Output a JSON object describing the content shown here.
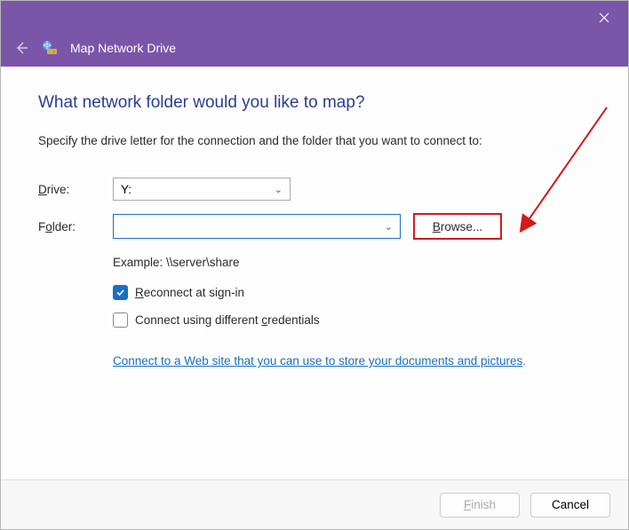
{
  "titlebar": {
    "close_tooltip": "Close"
  },
  "header": {
    "title": "Map Network Drive"
  },
  "content": {
    "heading": "What network folder would you like to map?",
    "instruction": "Specify the drive letter for the connection and the folder that you want to connect to:",
    "drive_label_pre": "D",
    "drive_label_post": "rive:",
    "drive_value": "Y:",
    "folder_label_pre": "F",
    "folder_label_post": "lder:",
    "folder_label_mid": "o",
    "folder_value": "",
    "browse_pre": "B",
    "browse_post": "rowse...",
    "example": "Example: \\\\server\\share",
    "reconnect_pre": "R",
    "reconnect_post": "econnect at sign-in",
    "credentials_pre": "Connect using different ",
    "credentials_ul": "c",
    "credentials_post": "redentials",
    "link_text": "Connect to a Web site that you can use to store your documents and pictures",
    "link_period": "."
  },
  "footer": {
    "finish_pre": "F",
    "finish_post": "inish",
    "cancel": "Cancel"
  }
}
